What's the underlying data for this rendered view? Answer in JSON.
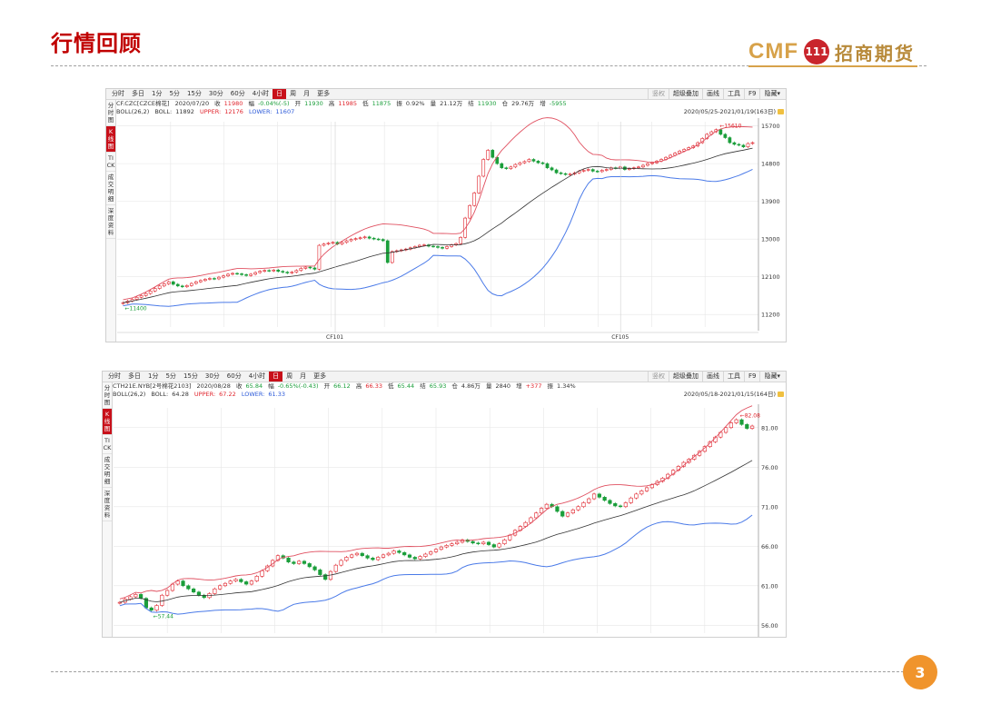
{
  "slide": {
    "title": "行情回顾",
    "logo_text": "CMF",
    "logo_badge": "111",
    "logo_cn": "招商期货",
    "page_number": "3"
  },
  "toolbar": {
    "items": [
      "分时",
      "多日",
      "1分",
      "5分",
      "15分",
      "30分",
      "60分",
      "4小时",
      "日",
      "周",
      "月",
      "更多"
    ],
    "active": "日",
    "right_items": [
      "竖权",
      "超级叠加",
      "画线",
      "工具",
      "F9",
      "隐藏▾"
    ]
  },
  "sidebar": {
    "items": [
      "分时图",
      "K线图",
      "TICK",
      "成交明细",
      "深度资料"
    ],
    "active": "K线图"
  },
  "colors": {
    "up": "#e0242c",
    "down": "#1a9e3a",
    "upper": "#e05060",
    "mid": "#333333",
    "lower": "#4a7ae8",
    "brand": "#c00000"
  },
  "chart_data": [
    {
      "type": "candlestick",
      "symbol": "CF.CZC[CZCE棉花]",
      "date": "2020/07/20",
      "quote": {
        "close_label": "收",
        "close": "11980",
        "chg_label": "幅",
        "chg": "-0.04%(-5)",
        "open_label": "开",
        "open": "11930",
        "high_label": "高",
        "high": "11985",
        "low_label": "低",
        "low": "11875",
        "amp_label": "振",
        "amp": "0.92%",
        "vol_label": "量",
        "vol": "21.12万",
        "settle_label": "结",
        "settle": "11930",
        "oi_label": "仓",
        "oi": "29.76万",
        "oichg_label": "增",
        "oichg": "-5955"
      },
      "boll": {
        "name": "BOLL(26,2)",
        "mid_label": "BOLL:",
        "mid": "11892",
        "upper_label": "UPPER:",
        "upper": "12176",
        "lower_label": "LOWER:",
        "lower": "11607"
      },
      "range_label": "2020/05/25-2021/01/19(163日)",
      "y_ticks": [
        "15700",
        "14800",
        "13900",
        "13000",
        "12100",
        "11200"
      ],
      "ylim": [
        10900,
        15800
      ],
      "x_labels": [
        "CF101",
        "CF105"
      ],
      "annotations": {
        "high": "15610",
        "low": "11400"
      },
      "close": [
        11480,
        11520,
        11560,
        11610,
        11650,
        11700,
        11760,
        11820,
        11880,
        11930,
        11980,
        11920,
        11880,
        11860,
        11890,
        11940,
        11980,
        12010,
        12040,
        12060,
        12050,
        12090,
        12120,
        12160,
        12180,
        12170,
        12150,
        12130,
        12160,
        12200,
        12230,
        12250,
        12240,
        12260,
        12230,
        12210,
        12190,
        12210,
        12250,
        12300,
        12330,
        12310,
        12280,
        12850,
        12880,
        12900,
        12920,
        12880,
        12920,
        12960,
        12990,
        13010,
        13030,
        13050,
        13020,
        13000,
        12990,
        12960,
        12440,
        12700,
        12720,
        12740,
        12760,
        12790,
        12820,
        12850,
        12860,
        12830,
        12820,
        12800,
        12780,
        12820,
        12860,
        12890,
        13040,
        13500,
        13800,
        14100,
        14500,
        14900,
        15120,
        14950,
        14800,
        14700,
        14680,
        14720,
        14780,
        14820,
        14850,
        14900,
        14860,
        14820,
        14800,
        14700,
        14650,
        14580,
        14560,
        14540,
        14550,
        14580,
        14620,
        14640,
        14660,
        14620,
        14610,
        14640,
        14660,
        14700,
        14690,
        14720,
        14660,
        14680,
        14700,
        14720,
        14760,
        14800,
        14820,
        14860,
        14900,
        14950,
        15000,
        15050,
        15100,
        15140,
        15180,
        15220,
        15300,
        15400,
        15500,
        15560,
        15610,
        15500,
        15420,
        15300,
        15260,
        15240,
        15200,
        15280,
        15300
      ]
    },
    {
      "type": "candlestick",
      "symbol": "CTH21E.NYB[2号棉花2103]",
      "date": "2020/08/28",
      "quote": {
        "close_label": "收",
        "close": "65.84",
        "chg_label": "幅",
        "chg": "-0.65%(-0.43)",
        "open_label": "开",
        "open": "66.12",
        "high_label": "高",
        "high": "66.33",
        "low_label": "低",
        "low": "65.44",
        "settle_label": "结",
        "settle": "65.93",
        "oi_label": "仓",
        "oi": "4.86万",
        "vol_label": "量",
        "vol": "2840",
        "oichg_label": "增",
        "oichg": "+377",
        "amp_label": "振",
        "amp": "1.34%"
      },
      "boll": {
        "name": "BOLL(26,2)",
        "mid_label": "BOLL:",
        "mid": "64.28",
        "upper_label": "UPPER:",
        "upper": "67.22",
        "lower_label": "LOWER:",
        "lower": "61.33"
      },
      "range_label": "2020/05/18-2021/01/15(164日)",
      "y_ticks": [
        "81.00",
        "76.00",
        "71.00",
        "66.00",
        "61.00",
        "56.00"
      ],
      "ylim": [
        55.0,
        83.5
      ],
      "annotations": {
        "high": "82.08",
        "low": "57.44"
      },
      "close": [
        58.9,
        59.3,
        59.6,
        59.9,
        59.4,
        58.2,
        57.9,
        58.5,
        59.8,
        60.4,
        61.2,
        61.6,
        61.0,
        60.6,
        60.2,
        59.8,
        59.5,
        60.0,
        60.6,
        61.0,
        61.3,
        61.6,
        61.8,
        61.5,
        61.2,
        61.6,
        62.2,
        62.9,
        63.5,
        64.2,
        64.8,
        64.5,
        64.0,
        63.8,
        64.1,
        63.8,
        63.4,
        63.0,
        62.4,
        61.8,
        62.8,
        63.6,
        64.2,
        64.6,
        64.9,
        65.1,
        64.8,
        64.5,
        64.3,
        64.6,
        64.9,
        65.1,
        65.4,
        65.2,
        64.9,
        64.6,
        64.4,
        64.7,
        65.0,
        65.3,
        65.6,
        65.9,
        66.1,
        66.3,
        66.5,
        66.8,
        66.6,
        66.4,
        66.3,
        66.5,
        66.2,
        65.9,
        66.3,
        66.8,
        67.4,
        68.0,
        68.5,
        69.0,
        69.6,
        70.2,
        70.8,
        71.3,
        71.0,
        70.4,
        69.8,
        70.2,
        70.6,
        71.0,
        71.5,
        72.0,
        72.6,
        72.2,
        71.8,
        71.4,
        71.1,
        71.0,
        71.5,
        72.1,
        72.6,
        73.0,
        73.4,
        73.8,
        74.2,
        74.6,
        75.1,
        75.6,
        76.1,
        76.6,
        77.0,
        77.5,
        78.0,
        78.6,
        79.2,
        79.8,
        80.4,
        81.0,
        81.6,
        82.0,
        81.4,
        80.9,
        81.2
      ]
    }
  ]
}
